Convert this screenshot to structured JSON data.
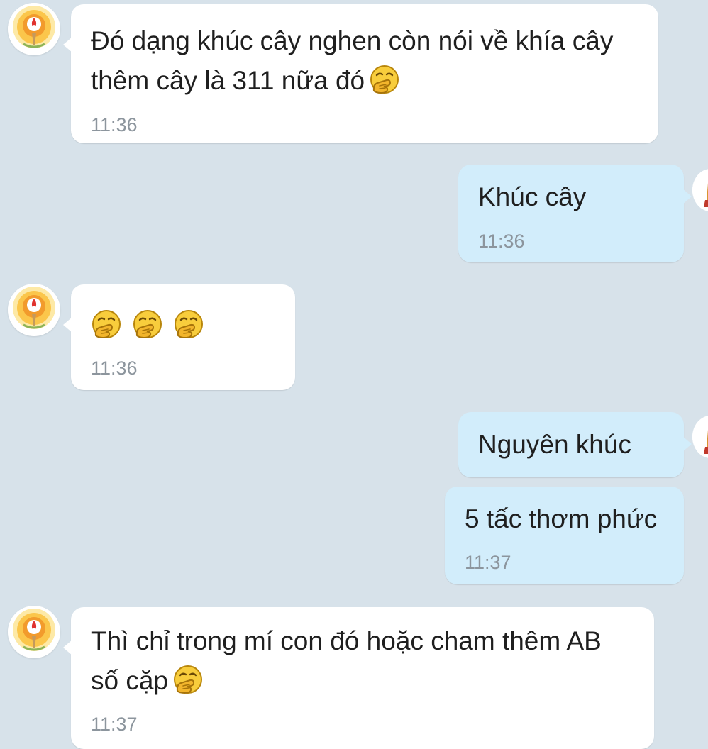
{
  "colors": {
    "background": "#d7e2ea",
    "incoming_bubble": "#ffffff",
    "outgoing_bubble": "#d2edfb",
    "message_text": "#1f1f1f",
    "timestamp_text": "#8c959d"
  },
  "icons": {
    "sender_avatar": "sun-torch-emblem-avatar",
    "self_avatar": "golden-figure-avatar",
    "emoji": "hand-over-mouth-face-emoji"
  },
  "messages": [
    {
      "direction": "incoming",
      "lines": [
        "Đó dạng khúc cây nghen còn nói về khía cây",
        "thêm cây là 311 nữa đó"
      ],
      "time": "11:36"
    },
    {
      "direction": "outgoing",
      "lines": [
        "Khúc cây"
      ],
      "time": "11:36"
    },
    {
      "direction": "incoming",
      "emoji_count": 3,
      "time": "11:36"
    },
    {
      "direction": "outgoing",
      "lines": [
        "Nguyên khúc"
      ]
    },
    {
      "direction": "outgoing",
      "lines": [
        "5 tấc thơm phức"
      ],
      "time": "11:37"
    },
    {
      "direction": "incoming",
      "lines": [
        "Thì chỉ trong mí con đó hoặc cham thêm AB",
        "số cặp"
      ],
      "time": "11:37"
    }
  ]
}
